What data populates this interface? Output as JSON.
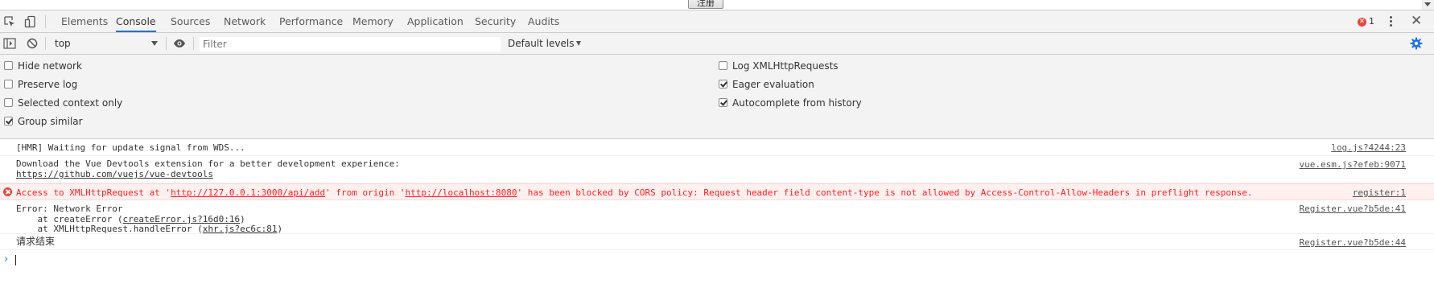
{
  "page": {
    "register_button_label": "注册"
  },
  "devtools": {
    "tabs": [
      "Elements",
      "Console",
      "Sources",
      "Network",
      "Performance",
      "Memory",
      "Application",
      "Security",
      "Audits"
    ],
    "active_tab": "Console",
    "error_badge_count": "1",
    "accent_color": "#1a73e8",
    "error_color": "#e8453c",
    "icons": {
      "inspect": "inspect-element-icon",
      "device": "device-toolbar-icon",
      "menu": "kebab-menu-icon",
      "close": "close-icon"
    }
  },
  "console_toolbar": {
    "context_value": "top",
    "filter_placeholder": "Filter",
    "levels_label": "Default levels"
  },
  "settings": {
    "left": [
      {
        "label": "Hide network",
        "checked": false
      },
      {
        "label": "Preserve log",
        "checked": false
      },
      {
        "label": "Selected context only",
        "checked": false
      },
      {
        "label": "Group similar",
        "checked": true
      }
    ],
    "right": [
      {
        "label": "Log XMLHttpRequests",
        "checked": false
      },
      {
        "label": "Eager evaluation",
        "checked": true
      },
      {
        "label": "Autocomplete from history",
        "checked": true
      }
    ]
  },
  "messages": [
    {
      "level": "log",
      "text": "[HMR] Waiting for update signal from WDS...",
      "source": "log.js?4244:23"
    },
    {
      "level": "log",
      "line1": "Download the Vue Devtools extension for a better development experience:",
      "link": "https://github.com/vuejs/vue-devtools",
      "source": "vue.esm.js?efeb:9071"
    },
    {
      "level": "error",
      "pre": "Access to XMLHttpRequest at '",
      "url1": "http://127.0.0.1:3000/api/add",
      "mid": "' from origin '",
      "url2": "http://localhost:8080",
      "post": "' has been blocked by CORS policy: Request header field content-type is not allowed by Access-Control-Allow-Headers in preflight response.",
      "source": "register:1"
    },
    {
      "level": "log",
      "line1": "Error: Network Error",
      "line2_pre": "    at createError (",
      "line2_link": "createError.js?16d0:16",
      "line2_post": ")",
      "line3_pre": "    at XMLHttpRequest.handleError (",
      "line3_link": "xhr.js?ec6c:81",
      "line3_post": ")",
      "source": "Register.vue?b5de:41"
    },
    {
      "level": "log",
      "text": "请求结束",
      "source": "Register.vue?b5de:44"
    }
  ],
  "prompt_symbol": "›"
}
